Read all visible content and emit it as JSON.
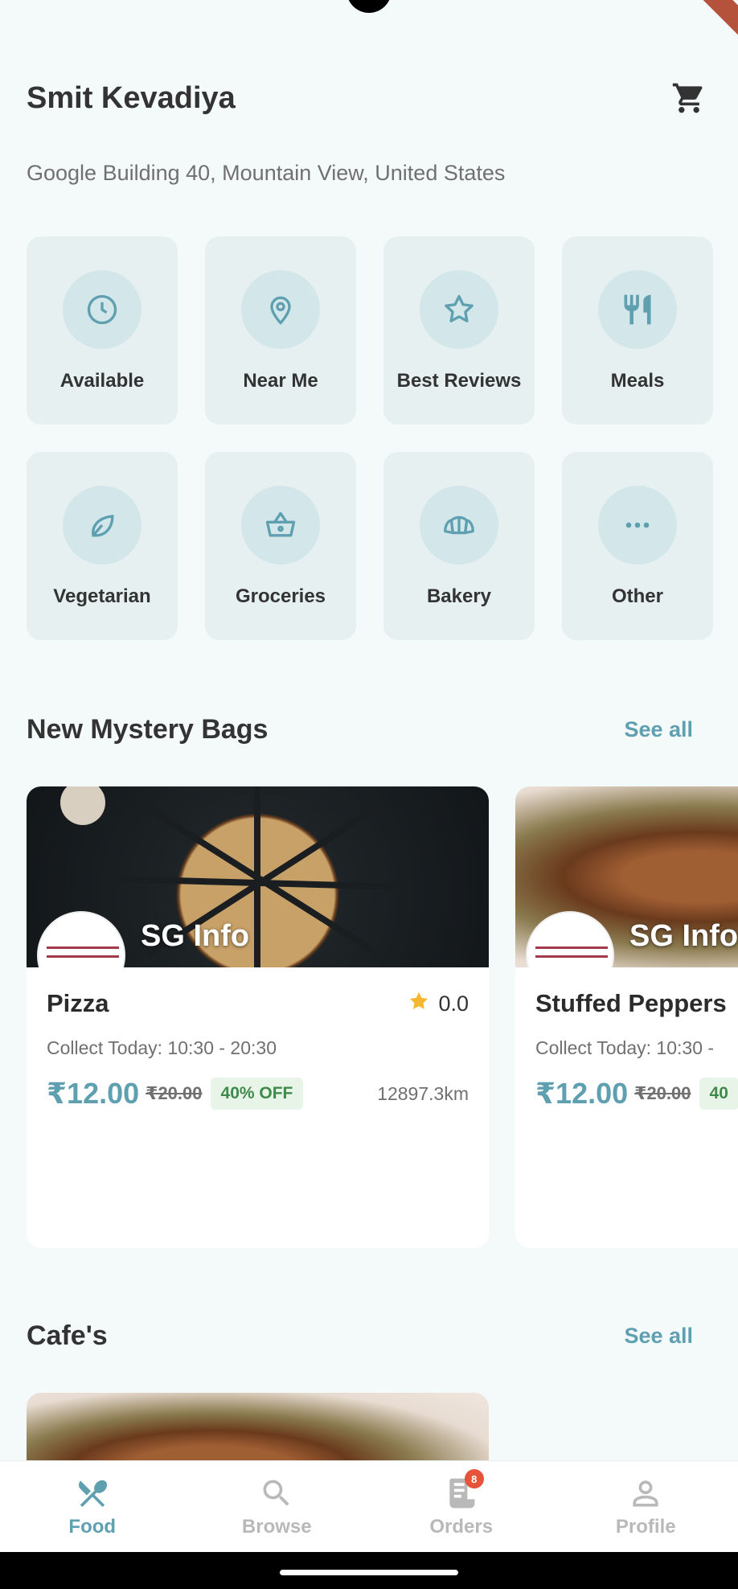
{
  "header": {
    "username": "Smit Kevadiya",
    "address": "Google Building 40, Mountain View, United States"
  },
  "categories": [
    {
      "label": "Available",
      "icon": "clock-icon"
    },
    {
      "label": "Near Me",
      "icon": "location-pin-icon"
    },
    {
      "label": "Best Reviews",
      "icon": "star-icon"
    },
    {
      "label": "Meals",
      "icon": "cutlery-icon"
    },
    {
      "label": "Vegetarian",
      "icon": "leaf-icon"
    },
    {
      "label": "Groceries",
      "icon": "basket-icon"
    },
    {
      "label": "Bakery",
      "icon": "croissant-icon"
    },
    {
      "label": "Other",
      "icon": "more-dots-icon"
    }
  ],
  "mystery_bags": {
    "title": "New Mystery Bags",
    "see_all": "See all",
    "cards": [
      {
        "brand": "SG Info",
        "title": "Pizza",
        "rating": "0.0",
        "collect": "Collect Today: 10:30 - 20:30",
        "price": "₹12.00",
        "old_price": "₹20.00",
        "discount": "40% OFF",
        "distance": "12897.3km"
      },
      {
        "brand": "SG Info",
        "title": "Stuffed Peppers",
        "collect": "Collect Today: 10:30 -",
        "price": "₹12.00",
        "old_price": "₹20.00",
        "discount": "40"
      }
    ]
  },
  "cafes": {
    "title": "Cafe's",
    "see_all": "See all"
  },
  "nav": {
    "items": [
      {
        "label": "Food",
        "icon": "fork-spoon-icon",
        "active": true
      },
      {
        "label": "Browse",
        "icon": "search-icon"
      },
      {
        "label": "Orders",
        "icon": "receipt-icon",
        "badge": "8"
      },
      {
        "label": "Profile",
        "icon": "person-icon"
      }
    ]
  },
  "colors": {
    "accent": "#5e9fb0",
    "background": "#f4f9fa",
    "category_bg": "#e6f0f1",
    "discount_green": "#3e8a4a",
    "badge_red": "#e4533a"
  }
}
